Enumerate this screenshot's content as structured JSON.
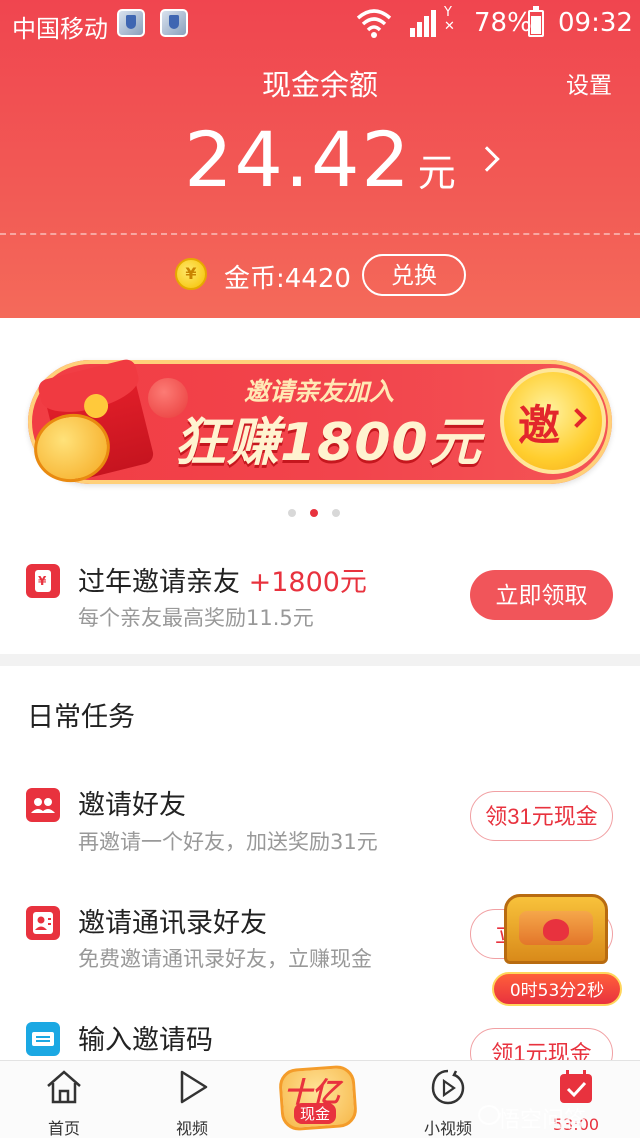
{
  "status_bar": {
    "carrier": "中国移动",
    "sim_label": "E\n2",
    "battery": "78%",
    "time": "09:32"
  },
  "header": {
    "title": "现金余额",
    "settings": "设置",
    "balance": "24.42",
    "balance_unit": "元",
    "coin_symbol": "¥",
    "coins_label": "金币:4420",
    "exchange": "兑换"
  },
  "banner": {
    "subtitle": "邀请亲友加入",
    "headline": "狂赚1800元",
    "badge": "邀",
    "carousel_total": 3,
    "carousel_active": 2
  },
  "promo": {
    "icon_text": "¥",
    "title": "过年邀请亲友",
    "bonus": "+1800元",
    "subtitle": "每个亲友最高奖励11.5元",
    "action": "立即领取"
  },
  "daily": {
    "title": "日常任务",
    "tasks": [
      {
        "icon": "friends-icon",
        "title": "邀请好友",
        "subtitle": "再邀请一个好友，加送奖励31元",
        "action": "领31元现金"
      },
      {
        "icon": "contacts-icon",
        "title": "邀请通讯录好友",
        "subtitle": "免费邀请通讯录好友，立赚现金",
        "action": "立"
      },
      {
        "icon": "ticket-icon",
        "title": "输入邀请码",
        "subtitle": "",
        "action": "领1元现金"
      }
    ]
  },
  "chest": {
    "timer": "0时53分2秒"
  },
  "tabbar": {
    "home": "首页",
    "video": "视频",
    "center_big": "十亿",
    "center_small": "现金",
    "short_video": "小视频",
    "tasks_time": "53:00"
  },
  "watermark": "悟空问答",
  "colors": {
    "accent": "#e8323e",
    "header_top": "#f0454f",
    "header_bottom": "#f46a5a",
    "link_blue": "#1ba8e3"
  }
}
